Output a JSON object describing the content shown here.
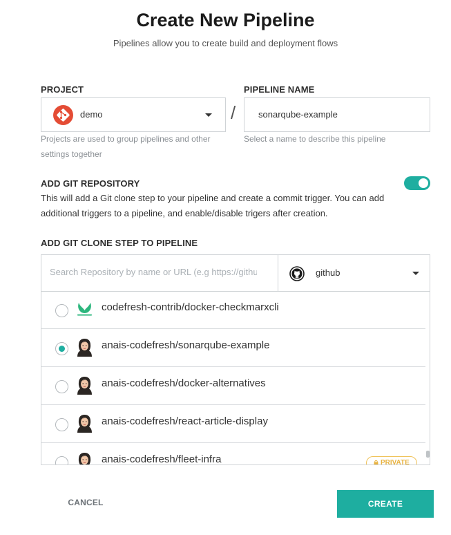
{
  "dialog": {
    "title": "Create New Pipeline",
    "subtitle": "Pipelines allow you to create build and deployment flows"
  },
  "project": {
    "label": "PROJECT",
    "value": "demo",
    "help_line1": "Projects are used to group pipelines and other",
    "help_line2": "settings together",
    "logo_icon": "git-logo-icon",
    "logo_color": "#e44c35"
  },
  "separator": "/",
  "pipeline_name": {
    "label": "PIPELINE NAME",
    "value": "sonarqube-example",
    "help": "Select a name to describe this pipeline"
  },
  "git_repository": {
    "label": "ADD GIT REPOSITORY",
    "toggle_on": true,
    "description_line1": "This will add a Git clone step to your pipeline and create a commit trigger. You can add",
    "description_line2": "additional triggers to a pipeline, and enable/disable trigers after creation."
  },
  "clone_step": {
    "label": "ADD GIT CLONE STEP TO PIPELINE",
    "search_placeholder": "Search Repository by name or URL (e.g https://github.com/...)",
    "provider": "github",
    "provider_icon": "github-icon",
    "repositories": [
      {
        "name": "codefresh-contrib/docker-checkmarxcli",
        "selected": false,
        "avatar": "codefresh-logo-icon",
        "badge": ""
      },
      {
        "name": "anais-codefresh/sonarqube-example",
        "selected": true,
        "avatar": "user-avatar",
        "badge": ""
      },
      {
        "name": "anais-codefresh/docker-alternatives",
        "selected": false,
        "avatar": "user-avatar",
        "badge": ""
      },
      {
        "name": "anais-codefresh/react-article-display",
        "selected": false,
        "avatar": "user-avatar",
        "badge": ""
      },
      {
        "name": "anais-codefresh/fleet-infra",
        "selected": false,
        "avatar": "user-avatar",
        "badge": "PRIVATE"
      }
    ]
  },
  "actions": {
    "cancel": "CANCEL",
    "create": "CREATE"
  },
  "colors": {
    "accent": "#1eaea0",
    "private_badge": "#e8b23f"
  }
}
